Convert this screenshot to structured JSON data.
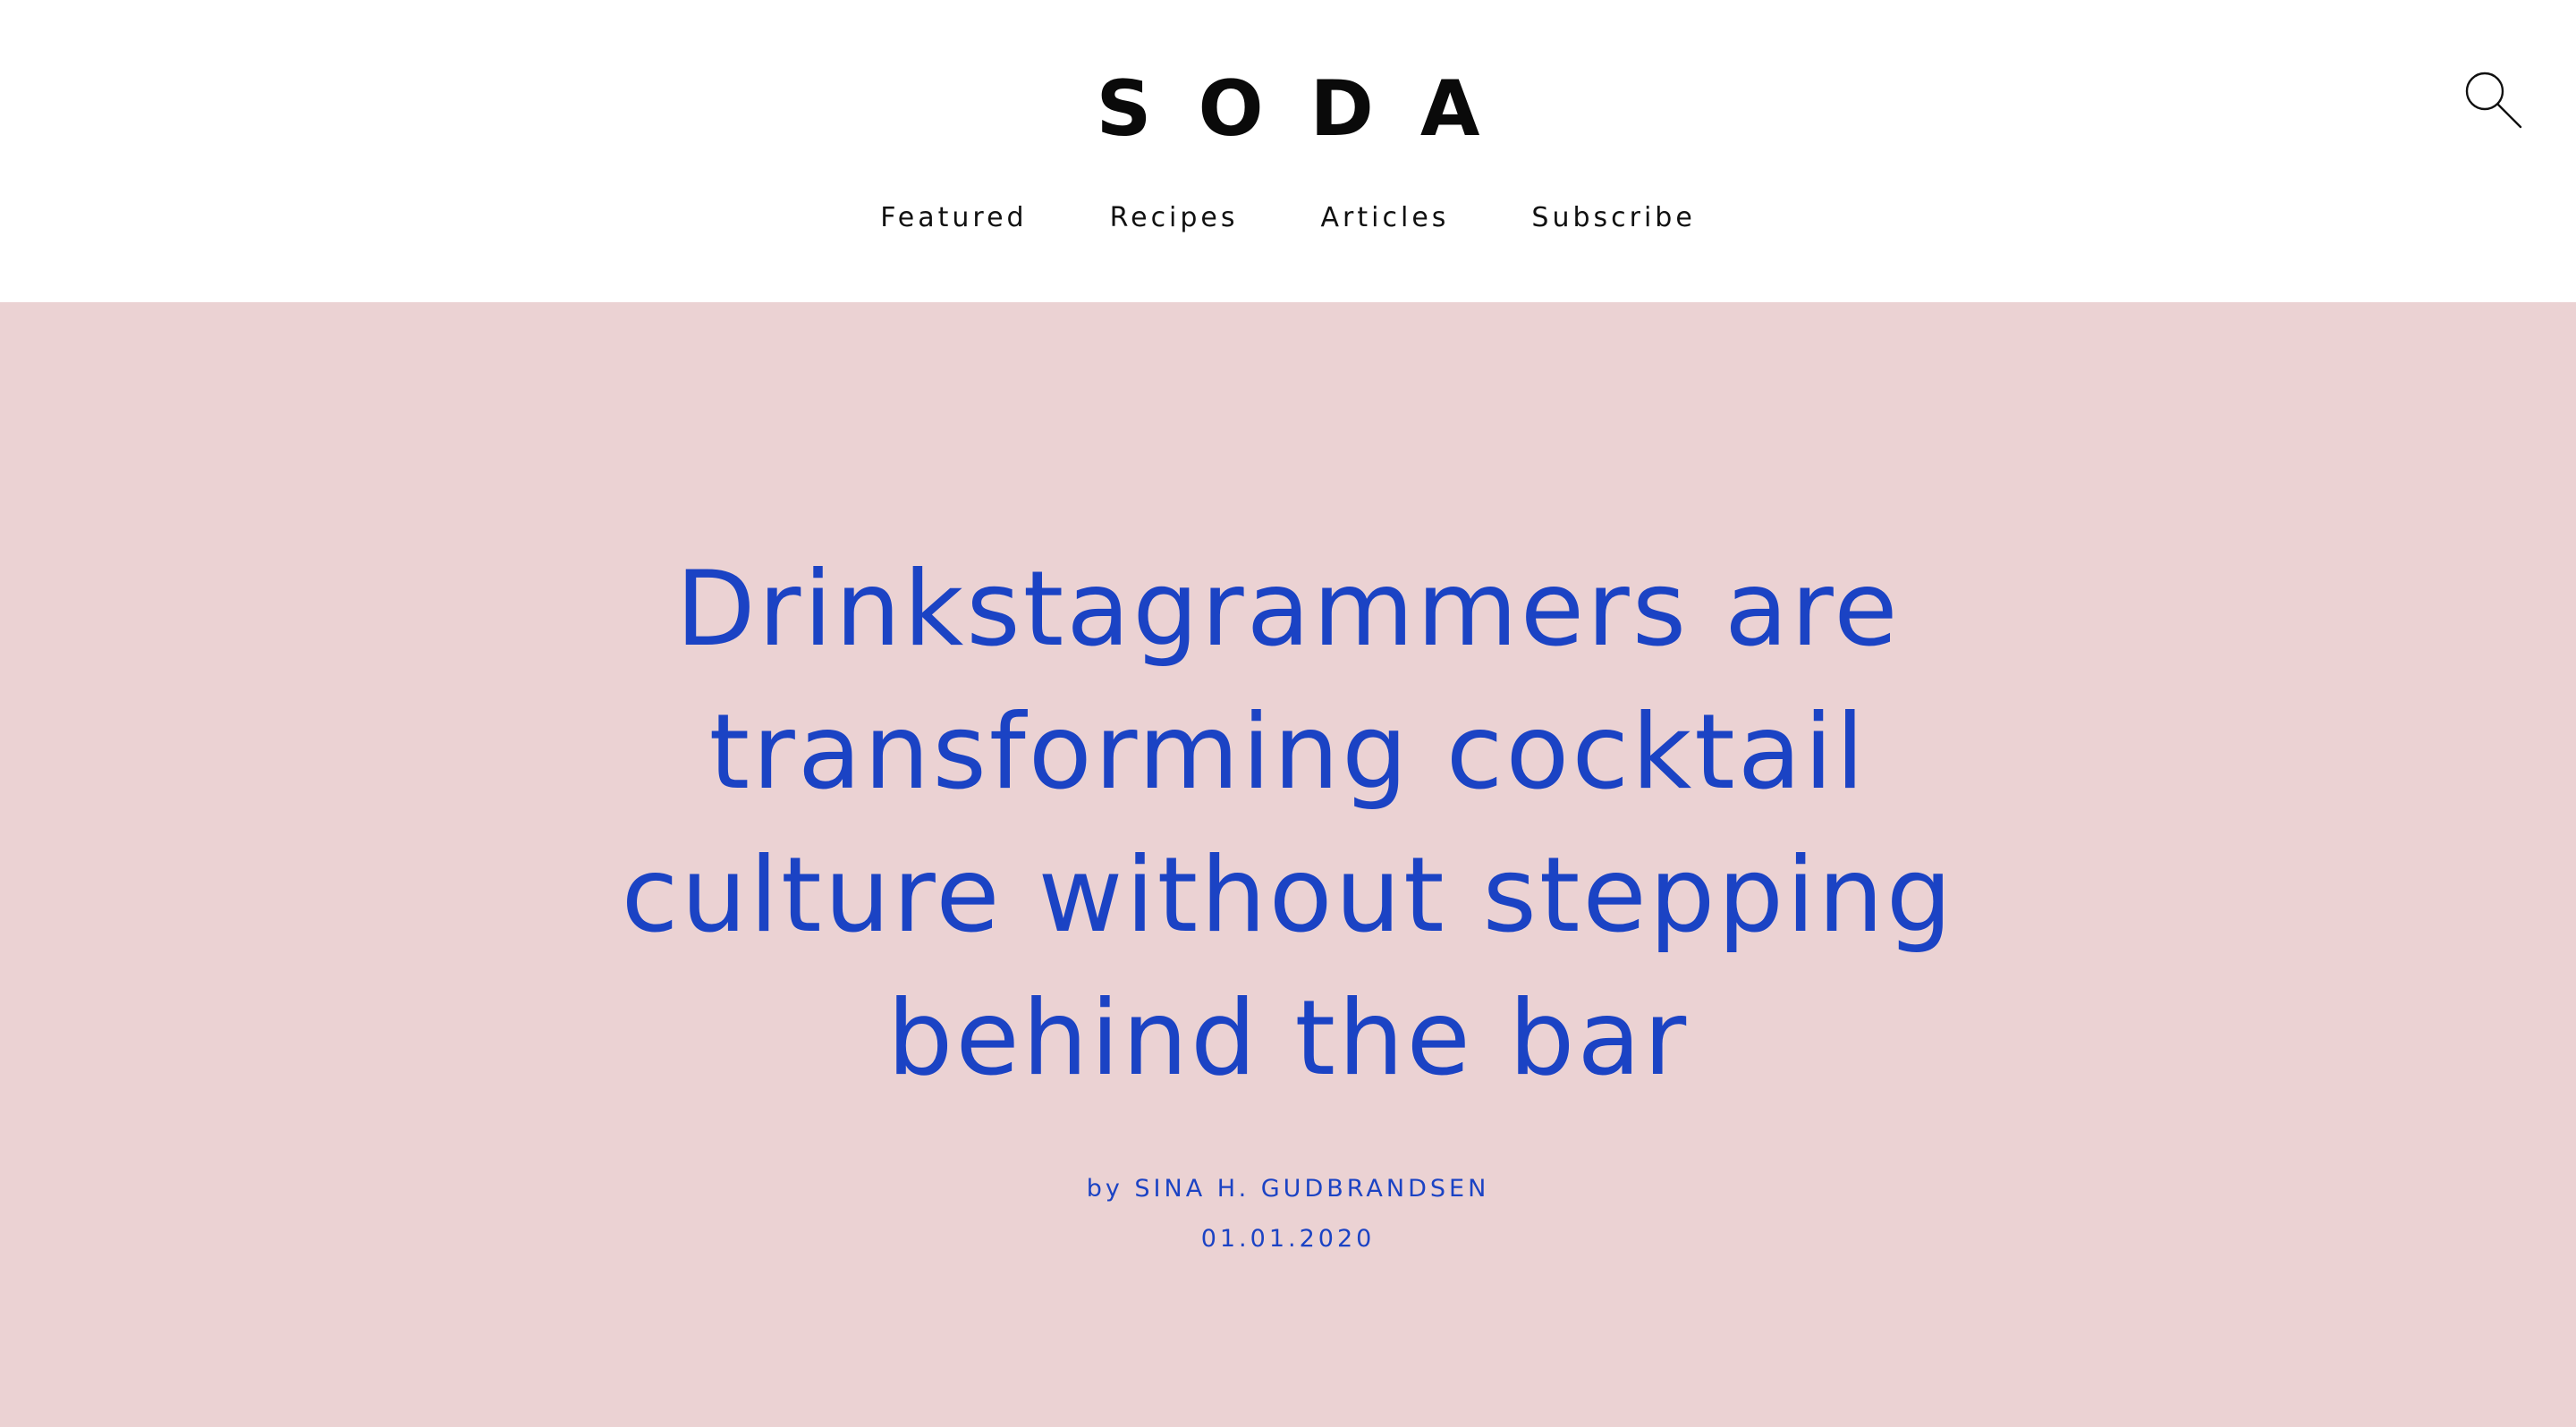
{
  "header": {
    "logo": "SODA",
    "search_icon": "search-icon"
  },
  "nav": {
    "items": [
      {
        "label": "Featured"
      },
      {
        "label": "Recipes"
      },
      {
        "label": "Articles"
      },
      {
        "label": "Subscribe"
      }
    ]
  },
  "article": {
    "title": "Drinkstagrammers are transforming cocktail culture without stepping behind the bar",
    "byline": "by SINA H. GUDBRANDSEN",
    "date": "01.01.2020"
  },
  "colors": {
    "hero_background": "#ebd2d3",
    "accent": "#1b43c4",
    "text_dark": "#0a0a0a"
  }
}
